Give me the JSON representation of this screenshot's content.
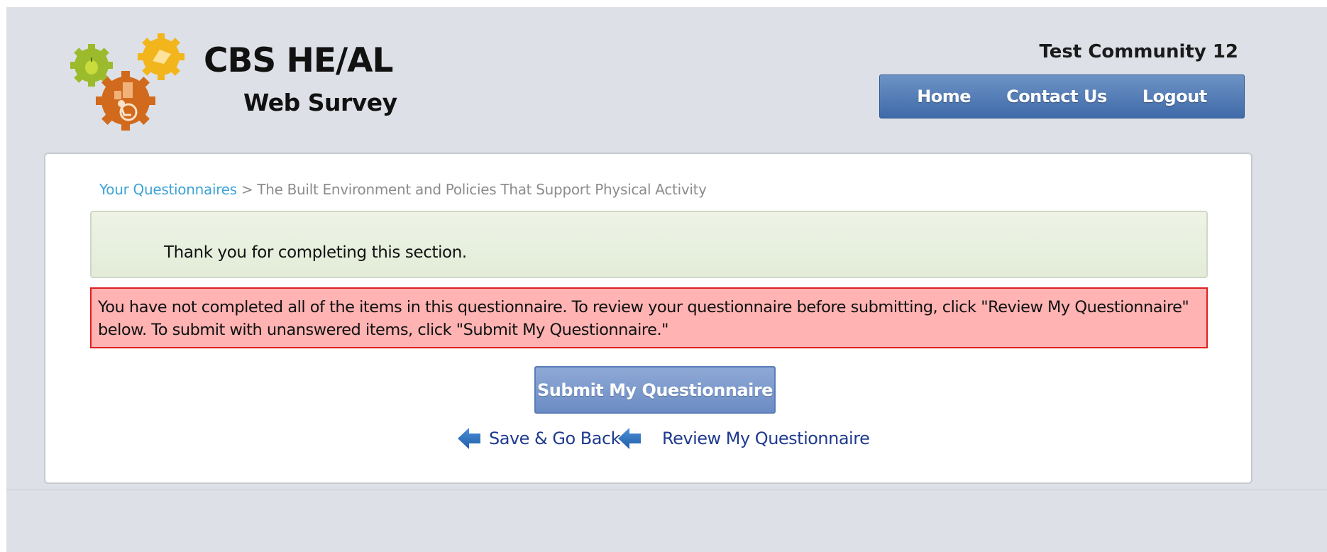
{
  "header": {
    "logo_title": "CBS HE/AL",
    "logo_subtitle": "Web Survey",
    "community_name": "Test Community 12",
    "nav": [
      {
        "label": "Home"
      },
      {
        "label": "Contact Us"
      },
      {
        "label": "Logout"
      }
    ]
  },
  "breadcrumb": {
    "link": "Your Questionnaires",
    "separator": ">",
    "current": "The Built Environment and Policies That Support Physical Activity"
  },
  "messages": {
    "success": "Thank you for completing this section.",
    "error": "You have not completed all of the items in this questionnaire. To review your questionnaire before submitting, click \"Review My Questionnaire\" below. To submit with unanswered items, click \"Submit My Questionnaire.\""
  },
  "actions": {
    "submit_label": "Submit My Questionnaire",
    "save_back_label": "Save & Go Back",
    "review_label": "Review My Questionnaire"
  },
  "colors": {
    "nav_bar": "#4a74b0",
    "link": "#3ea3d6",
    "error_bg": "#ffb3b3",
    "error_border": "#e02020",
    "success_bg": "#e6eedb",
    "action_link": "#1f3b8f"
  }
}
